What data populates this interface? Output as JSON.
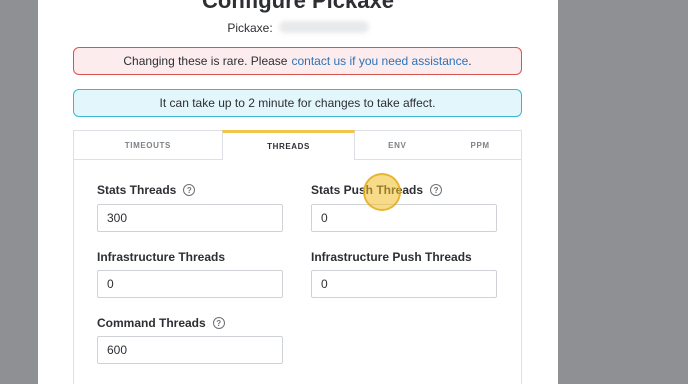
{
  "modal": {
    "title": "Configure Pickaxe",
    "pickaxe_label": "Pickaxe:"
  },
  "alerts": {
    "warning_text": "Changing these is rare. Please",
    "warning_link": "contact us if you need assistance",
    "warning_end": ".",
    "info_text": "It can take up to 2 minute for changes to take affect."
  },
  "tabs": [
    {
      "label": "TIMEOUTS"
    },
    {
      "label": "THREADS"
    },
    {
      "label": "ENV"
    },
    {
      "label": "PPM"
    }
  ],
  "fields": {
    "stats_threads": {
      "label": "Stats Threads",
      "value": "300"
    },
    "stats_push_threads": {
      "label": "Stats Push Threads",
      "value": "0"
    },
    "infrastructure_threads": {
      "label": "Infrastructure Threads",
      "value": "0"
    },
    "infrastructure_push_threads": {
      "label": "Infrastructure Push Threads",
      "value": "0"
    },
    "command_threads": {
      "label": "Command Threads",
      "value": "600"
    }
  },
  "colors": {
    "active_tab_accent": "#f2c447",
    "danger_border": "#d9534f",
    "info_border": "#38b8d4",
    "link": "#2a73b8"
  },
  "icons": {
    "help": "?"
  }
}
